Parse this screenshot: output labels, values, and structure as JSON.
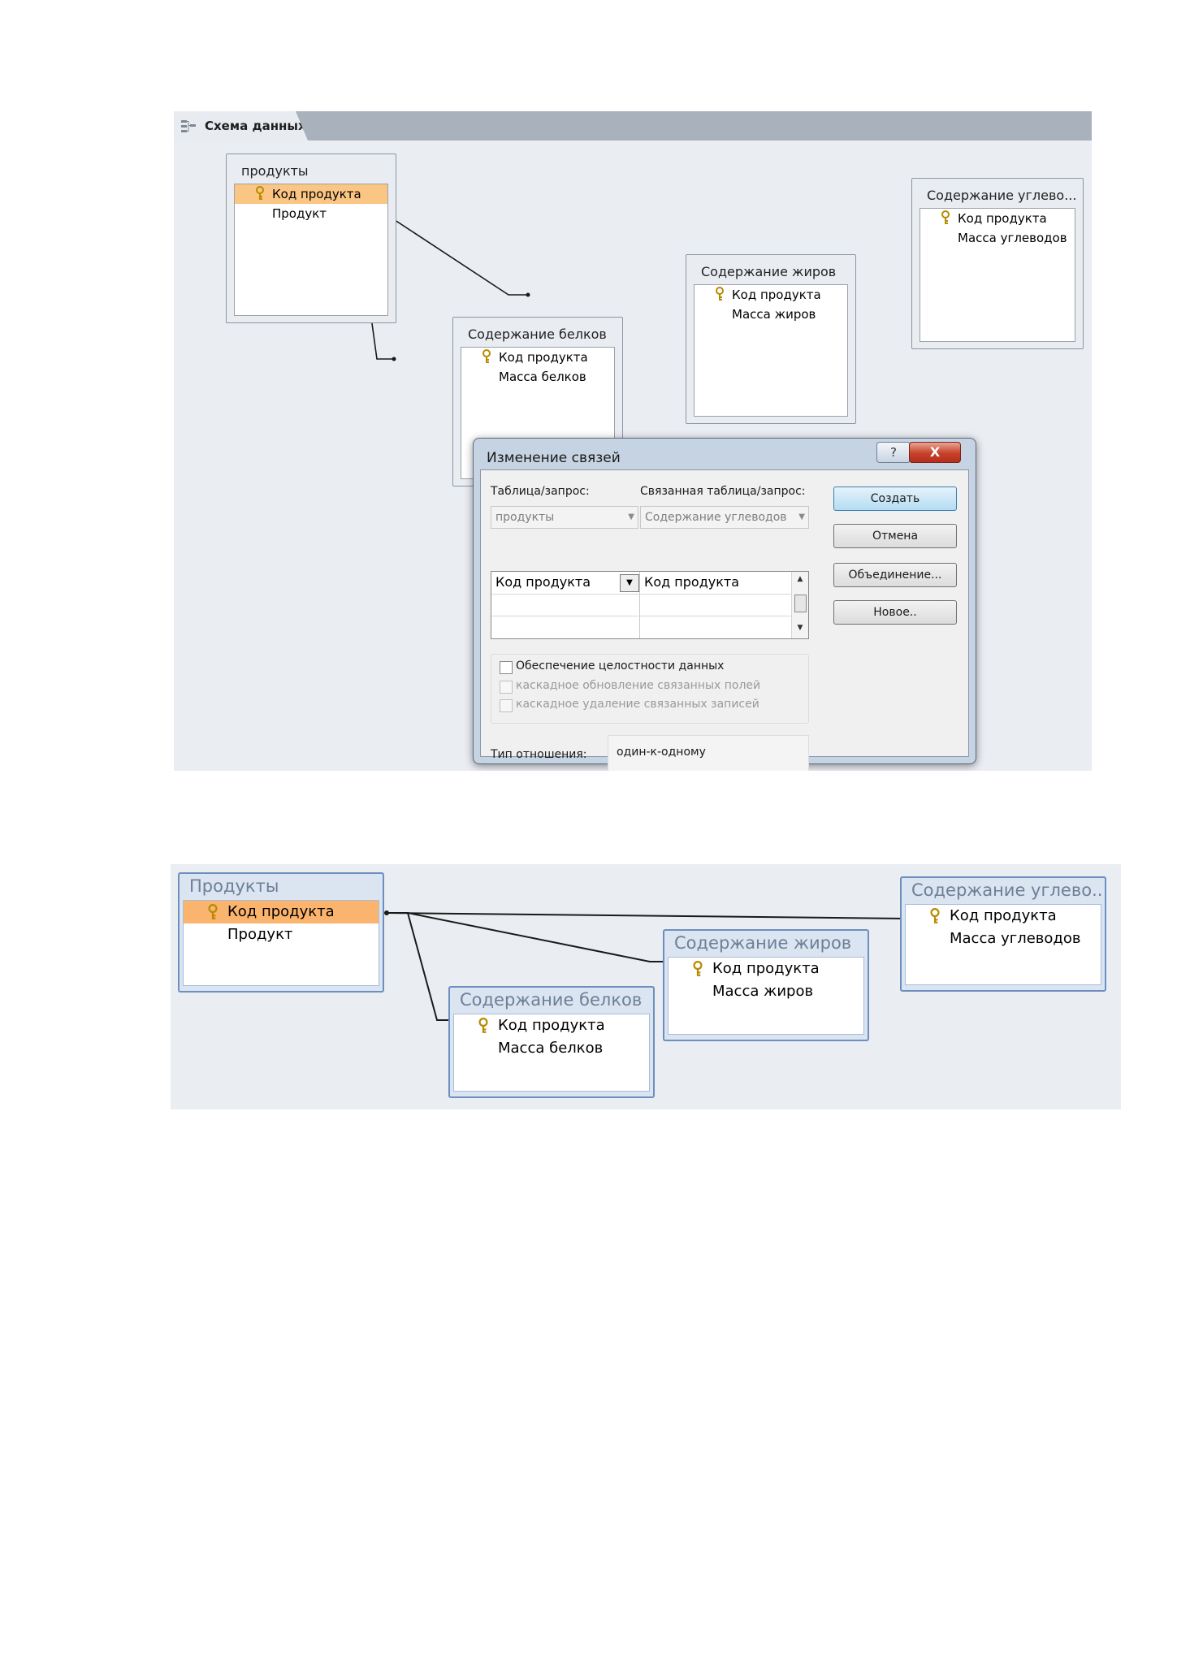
{
  "screenshot1": {
    "tab_label": "Схема данных",
    "tables": {
      "produkty": {
        "title": "продукты",
        "fields": [
          "Код продукта",
          "Продукт"
        ]
      },
      "belki": {
        "title": "Содержание белков",
        "fields": [
          "Код продукта",
          "Масса белков"
        ]
      },
      "zhiry": {
        "title": "Содержание жиров",
        "fields": [
          "Код продукта",
          "Масса жиров"
        ]
      },
      "uglevody": {
        "title": "Содержание углево...",
        "fields": [
          "Код продукта",
          "Масса углеводов"
        ]
      }
    },
    "dialog": {
      "title": "Изменение связей",
      "help_button": "?",
      "close_button": "X",
      "table_label": "Таблица/запрос:",
      "related_table_label": "Связанная таблица/запрос:",
      "table_value": "продукты",
      "related_table_value": "Содержание углеводов",
      "field_left": "Код продукта",
      "field_right": "Код продукта",
      "integrity_label": "Обеспечение целостности данных",
      "cascade_update_label": "каскадное обновление связанных полей",
      "cascade_delete_label": "каскадное удаление связанных записей",
      "relation_type_label": "Тип отношения:",
      "relation_type_value": "один-к-одному",
      "buttons": {
        "create": "Создать",
        "cancel": "Отмена",
        "join": "Объединение...",
        "new": "Новое.."
      }
    }
  },
  "screenshot2": {
    "tables": {
      "produkty": {
        "title": "Продукты",
        "fields": [
          "Код продукта",
          "Продукт"
        ]
      },
      "belki": {
        "title": "Содержание белков",
        "fields": [
          "Код продукта",
          "Масса белков"
        ]
      },
      "zhiry": {
        "title": "Содержание жиров",
        "fields": [
          "Код продукта",
          "Масса жиров"
        ]
      },
      "uglevody": {
        "title": "Содержание углево...",
        "fields": [
          "Код продукта",
          "Масса углеводов"
        ]
      }
    }
  },
  "colors": {
    "canvas_bg": "#eaedf2",
    "selected_row": "#fbc583",
    "table_border_blue": "#6d8fbf",
    "close_red": "#c6402a"
  }
}
